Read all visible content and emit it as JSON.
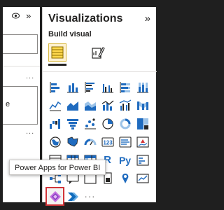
{
  "viz_pane": {
    "title": "Visualizations",
    "collapse_icon": "chevron-double-right-icon",
    "build_visual_label": "Build visual"
  },
  "left_pane": {
    "box2_text": "e",
    "more_options": "...",
    "icons": [
      "eye-icon",
      "chevron-double-right-icon"
    ]
  },
  "tooltip": {
    "text": "Power Apps for Power BI"
  },
  "more_visuals": "···",
  "colors": {
    "accent_blue": "#1f6bbf",
    "accent_teal": "#118dff",
    "red_highlight": "#d13438",
    "selected_tab_bg": "#fff1cf"
  },
  "visual_icons": [
    [
      "stacked-bar-chart-icon",
      "stacked-column-chart-icon",
      "clustered-bar-chart-icon",
      "clustered-column-chart-icon",
      "100-stacked-bar-chart-icon",
      "100-stacked-column-chart-icon"
    ],
    [
      "line-chart-icon",
      "area-chart-icon",
      "stacked-area-chart-icon",
      "line-and-stacked-column-chart-icon",
      "line-and-clustered-column-chart-icon",
      "ribbon-chart-icon"
    ],
    [
      "waterfall-chart-icon",
      "funnel-chart-icon",
      "scatter-chart-icon",
      "pie-chart-icon",
      "donut-chart-icon",
      "treemap-icon"
    ],
    [
      "map-icon",
      "filled-map-icon",
      "gauge-icon",
      "card-icon",
      "multi-row-card-icon",
      "kpi-icon"
    ],
    [
      "slicer-icon",
      "table-icon",
      "matrix-icon",
      "r-script-visual-icon",
      "python-visual-icon",
      "key-influencers-icon"
    ],
    [
      "decomposition-tree-icon",
      "qa-icon",
      "smart-narrative-icon",
      "paginated-report-icon",
      "azure-map-icon",
      "metrics-icon"
    ]
  ],
  "cell_text": {
    "r": "R",
    "py": "Py"
  }
}
